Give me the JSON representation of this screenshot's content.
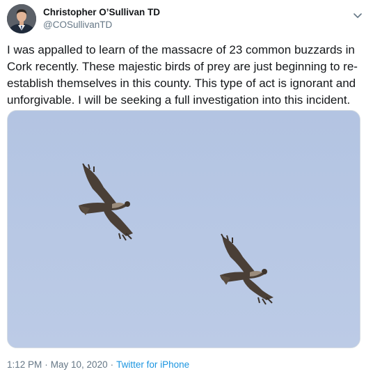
{
  "tweet": {
    "author_name": "Christopher O’Sullivan TD",
    "author_handle": "@COSullivanTD",
    "menu_icon": "chevron-down-icon",
    "text": "I was appalled to learn of the massacre of 23 common buzzards in Cork recently. These majestic birds of prey are just beginning to re-establish themselves in this county. This type of act is ignorant and unforgivable. I will be seeking a full investigation into this incident.",
    "time": "1:12 PM",
    "separator": "·",
    "date": "May 10, 2020",
    "source": "Twitter for iPhone"
  },
  "colors": {
    "text": "#14171a",
    "secondary": "#657786",
    "link": "#1b95e0",
    "sky": "#b7c7e3"
  }
}
